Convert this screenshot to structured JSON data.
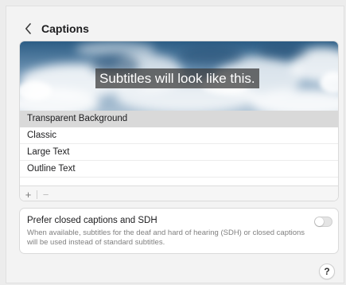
{
  "header": {
    "title": "Captions",
    "back_icon": "chevron-left-icon"
  },
  "preview": {
    "sample_text": "Subtitles will look like this.",
    "background_image": "sky-with-clouds"
  },
  "styles": {
    "items": [
      {
        "label": "Transparent Background",
        "selected": true
      },
      {
        "label": "Classic",
        "selected": false
      },
      {
        "label": "Large Text",
        "selected": false
      },
      {
        "label": "Outline Text",
        "selected": false
      }
    ],
    "toolbar": {
      "add_label": "+",
      "remove_label": "−",
      "remove_enabled": false
    }
  },
  "sdh_option": {
    "title": "Prefer closed captions and SDH",
    "description": "When available, subtitles for the deaf and hard of hearing (SDH) or closed captions will be used instead of standard subtitles.",
    "enabled": false
  },
  "help": {
    "label": "?"
  },
  "colors": {
    "window_background": "#f3f3f3",
    "card_background": "#ffffff",
    "selected_row": "#d9d9d9",
    "subtitle_box": "#373737"
  }
}
